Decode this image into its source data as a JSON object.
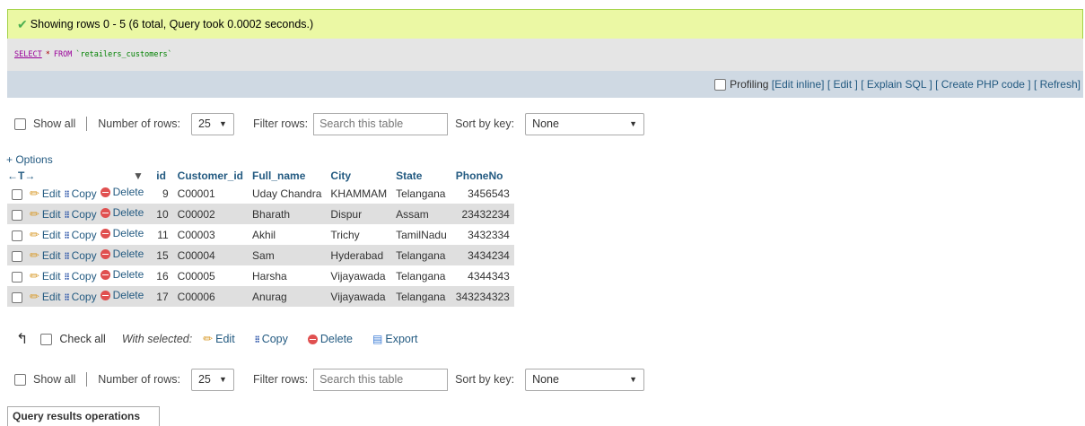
{
  "status": {
    "message": "Showing rows 0 - 5 (6 total, Query took 0.0002 seconds.)"
  },
  "sql": {
    "select": "SELECT",
    "star": "*",
    "from": "FROM",
    "table": "`retailers_customers`"
  },
  "tools": {
    "profiling": "Profiling",
    "edit_inline": "[Edit inline]",
    "edit": "[ Edit ]",
    "explain": "[ Explain SQL ]",
    "php": "[ Create PHP code ]",
    "refresh": "[ Refresh]"
  },
  "nav": {
    "show_all": "Show all",
    "rows_label": "Number of rows:",
    "rows_value": "25",
    "filter_label": "Filter rows:",
    "search_placeholder": "Search this table",
    "sort_label": "Sort by key:",
    "sort_value": "None"
  },
  "options_link": "+ Options",
  "table": {
    "arrows": "←T→",
    "sort_glyph": "▼",
    "columns": [
      "id",
      "Customer_id",
      "Full_name",
      "City",
      "State",
      "PhoneNo"
    ],
    "actions": {
      "edit": "Edit",
      "copy": "Copy",
      "delete": "Delete"
    },
    "rows": [
      [
        "9",
        "C00001",
        "Uday Chandra",
        "KHAMMAM",
        "Telangana",
        "3456543"
      ],
      [
        "10",
        "C00002",
        "Bharath",
        "Dispur",
        "Assam",
        "23432234"
      ],
      [
        "11",
        "C00003",
        "Akhil",
        "Trichy",
        "TamilNadu",
        "3432334"
      ],
      [
        "15",
        "C00004",
        "Sam",
        "Hyderabad",
        "Telangana",
        "3434234"
      ],
      [
        "16",
        "C00005",
        "Harsha",
        "Vijayawada",
        "Telangana",
        "4344343"
      ],
      [
        "17",
        "C00006",
        "Anurag",
        "Vijayawada",
        "Telangana",
        "343234323"
      ]
    ]
  },
  "bulk": {
    "check_all": "Check all",
    "with_selected": "With selected:",
    "edit": "Edit",
    "copy": "Copy",
    "delete": "Delete",
    "export": "Export"
  },
  "query_ops": "Query results operations",
  "colors": {
    "success_bg": "#ebf8a4",
    "toolbar_bg": "#cfd9e3",
    "link": "#235a81",
    "row_alt": "#dfdfdf"
  }
}
